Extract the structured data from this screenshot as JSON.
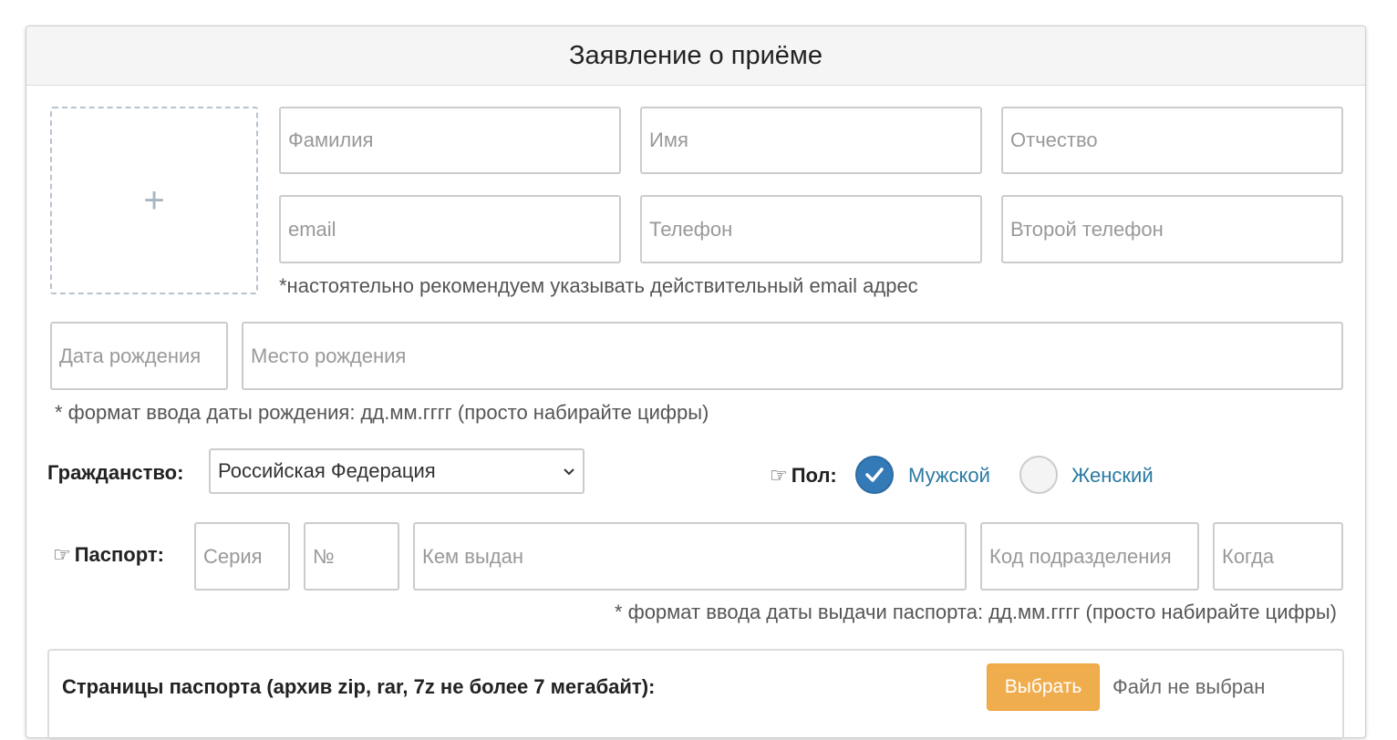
{
  "panel": {
    "title": "Заявление о приёме"
  },
  "photo": {
    "plus": "+"
  },
  "fields": {
    "last_name": "Фамилия",
    "first_name": "Имя",
    "patronymic": "Отчество",
    "email": "email",
    "phone": "Телефон",
    "phone2": "Второй телефон",
    "birth_date": "Дата рождения",
    "birth_place": "Место рождения",
    "passport_series": "Серия",
    "passport_number": "№",
    "passport_issued_by": "Кем выдан",
    "passport_division_code": "Код подразделения",
    "passport_when": "Когда"
  },
  "hints": {
    "email": "*настоятельно рекомендуем указывать действительный email адрес",
    "birth_date": "* формат ввода даты рождения: дд.мм.гггг (просто набирайте цифры)",
    "passport_date": "* формат ввода даты выдачи паспорта: дд.мм.гггг (просто набирайте цифры)"
  },
  "citizenship": {
    "label": "Гражданство:",
    "selected": "Российская Федерация"
  },
  "gender": {
    "label": "Пол:",
    "options": [
      {
        "label": "Мужской",
        "selected": true
      },
      {
        "label": "Женский",
        "selected": false
      }
    ]
  },
  "passport": {
    "label": "Паспорт:"
  },
  "passport_scan": {
    "label": "Страницы паспорта (архив zip, rar, 7z не более 7 мегабайт):",
    "button": "Выбрать",
    "status": "Файл не выбран"
  },
  "icons": {
    "hand": "☞"
  },
  "colors": {
    "accent_blue": "#337ab7",
    "radio_label": "#2a7aa1",
    "button_orange": "#f0ad4e"
  }
}
